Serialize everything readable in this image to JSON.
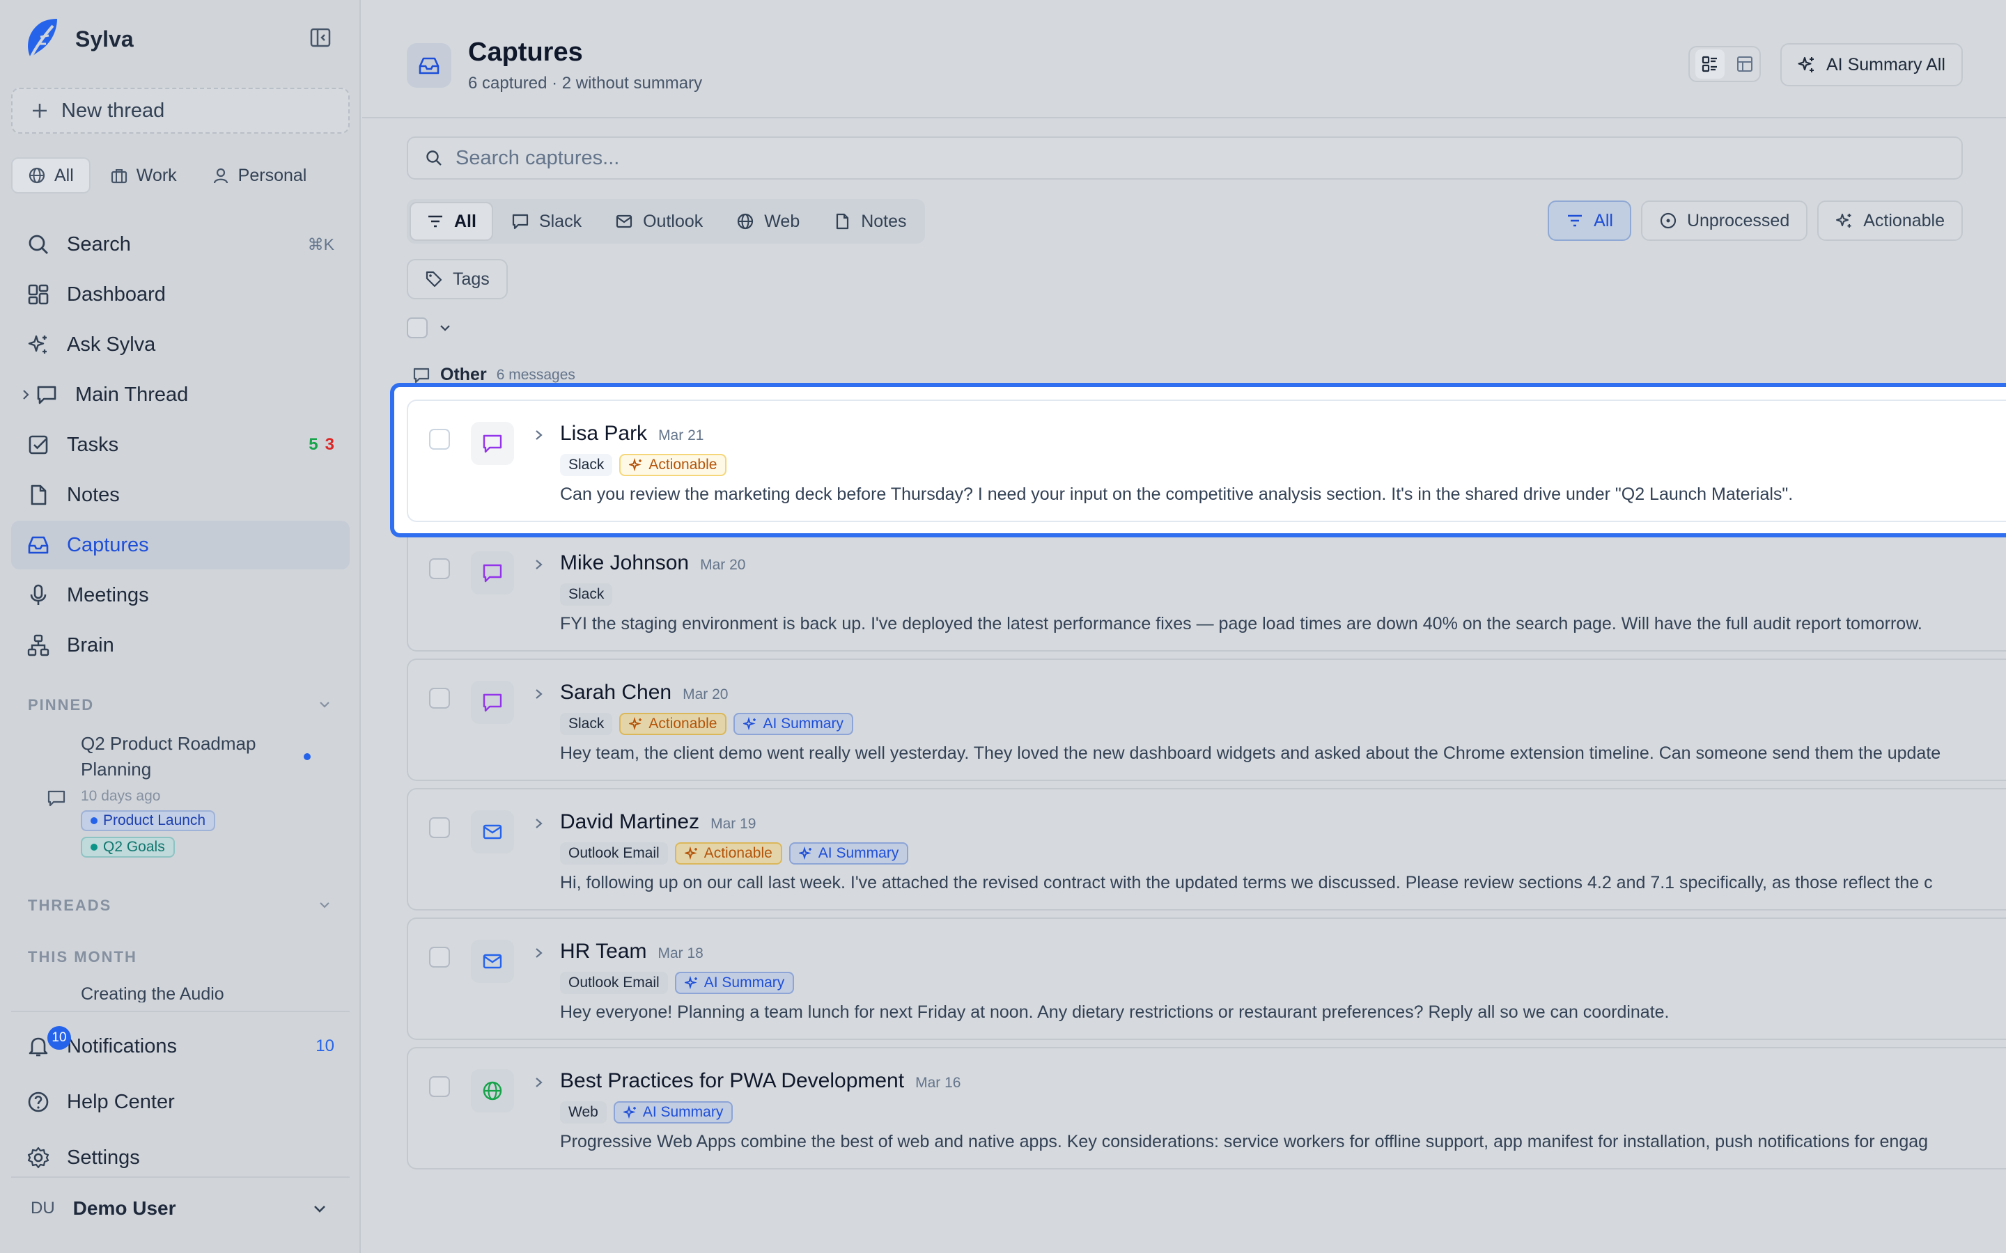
{
  "app": {
    "name": "Sylva",
    "brand_color": "#2563eb"
  },
  "sidebar": {
    "new_thread": "New thread",
    "scopes": [
      {
        "label": "All",
        "icon": "globe-icon",
        "active": true
      },
      {
        "label": "Work",
        "icon": "briefcase-icon",
        "active": false
      },
      {
        "label": "Personal",
        "icon": "user-icon",
        "active": false
      }
    ],
    "nav": {
      "search": {
        "label": "Search",
        "shortcut": "⌘K"
      },
      "dashboard": {
        "label": "Dashboard"
      },
      "ask": {
        "label": "Ask Sylva"
      },
      "main_thread": {
        "label": "Main Thread"
      },
      "tasks": {
        "label": "Tasks",
        "count_green": "5",
        "count_red": "3"
      },
      "notes": {
        "label": "Notes"
      },
      "captures": {
        "label": "Captures"
      },
      "meetings": {
        "label": "Meetings"
      },
      "brain": {
        "label": "Brain"
      }
    },
    "pinned": {
      "heading": "PINNED",
      "item": {
        "title": "Q2 Product Roadmap Planning",
        "time": "10 days ago",
        "tags": [
          "Product Launch",
          "Q2 Goals"
        ]
      }
    },
    "threads_heading": "THREADS",
    "this_month_heading": "THIS MONTH",
    "this_month_item": "Creating the Audio",
    "bottom": {
      "notifications": {
        "label": "Notifications",
        "badge": "10",
        "count": "10"
      },
      "help": {
        "label": "Help Center"
      },
      "settings": {
        "label": "Settings"
      }
    },
    "user": {
      "initials": "DU",
      "name": "Demo User"
    }
  },
  "header": {
    "title": "Captures",
    "subtitle": "6 captured · 2 without summary",
    "ai_summary_all": "AI Summary All"
  },
  "search": {
    "placeholder": "Search captures..."
  },
  "source_filters": [
    "All",
    "Slack",
    "Outlook",
    "Web",
    "Notes"
  ],
  "state_filters": [
    "All",
    "Unprocessed",
    "Actionable"
  ],
  "tags_button": "Tags",
  "group": {
    "name": "Other",
    "count": "6 messages"
  },
  "captures": [
    {
      "sender": "Lisa Park",
      "date": "Mar 21",
      "source": "Slack",
      "icon": "chat-icon",
      "actionable": "Actionable",
      "ai": "",
      "text": "Can you review the marketing deck before Thursday? I need your input on the competitive analysis section. It's in the shared drive under \"Q2 Launch Materials\"."
    },
    {
      "sender": "Mike Johnson",
      "date": "Mar 20",
      "source": "Slack",
      "icon": "chat-icon",
      "actionable": "",
      "ai": "",
      "text": "FYI the staging environment is back up. I've deployed the latest performance fixes — page load times are down 40% on the search page. Will have the full audit report tomorrow."
    },
    {
      "sender": "Sarah Chen",
      "date": "Mar 20",
      "source": "Slack",
      "icon": "chat-icon",
      "actionable": "Actionable",
      "ai": "AI Summary",
      "text": "Hey team, the client demo went really well yesterday. They loved the new dashboard widgets and asked about the Chrome extension timeline. Can someone send them the update"
    },
    {
      "sender": "David Martinez",
      "date": "Mar 19",
      "source": "Outlook Email",
      "icon": "mail-icon",
      "actionable": "Actionable",
      "ai": "AI Summary",
      "text": "Hi, following up on our call last week. I've attached the revised contract with the updated terms we discussed. Please review sections 4.2 and 7.1 specifically, as those reflect the c"
    },
    {
      "sender": "HR Team",
      "date": "Mar 18",
      "source": "Outlook Email",
      "icon": "mail-icon",
      "actionable": "",
      "ai": "AI Summary",
      "text": "Hey everyone! Planning a team lunch for next Friday at noon. Any dietary restrictions or restaurant preferences? Reply all so we can coordinate."
    },
    {
      "sender": "Best Practices for PWA Development",
      "date": "Mar 16",
      "source": "Web",
      "icon": "globe-icon",
      "actionable": "",
      "ai": "AI Summary",
      "text": "Progressive Web Apps combine the best of web and native apps. Key considerations: service workers for offline support, app manifest for installation, push notifications for engag"
    }
  ],
  "colors": {
    "focus_ring": "#2f6ff0",
    "actionable": "#b45309",
    "ai": "#1d4ed8",
    "slack_icon": "#9333ea",
    "mail_icon": "#2563eb",
    "web_icon": "#16a34a"
  }
}
